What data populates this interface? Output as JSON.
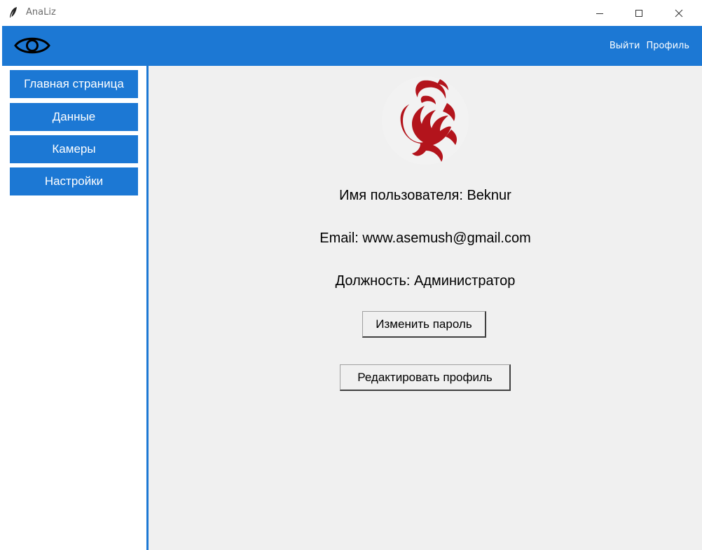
{
  "window": {
    "title": "AnaLiz",
    "icon": "feather-icon",
    "controls": [
      "minimize-icon",
      "maximize-icon",
      "close-icon"
    ]
  },
  "header": {
    "logo_icon": "eye-icon",
    "links": {
      "logout": "Выйти",
      "profile": "Профиль"
    }
  },
  "sidebar": {
    "items": [
      {
        "label": "Главная страница"
      },
      {
        "label": "Данные"
      },
      {
        "label": "Камеры"
      },
      {
        "label": "Настройки"
      }
    ]
  },
  "profile": {
    "avatar_icon": "phoenix-logo",
    "username_line": "Имя пользователя: Beknur",
    "email_line": "Email: www.asemush@gmail.com",
    "role_line": "Должность: Администратор",
    "change_password_label": "Изменить пароль",
    "edit_profile_label": "Редактировать профиль"
  },
  "colors": {
    "accent": "#1c78d4",
    "content_bg": "#f0f0f0",
    "logo_red": "#b3141c"
  }
}
